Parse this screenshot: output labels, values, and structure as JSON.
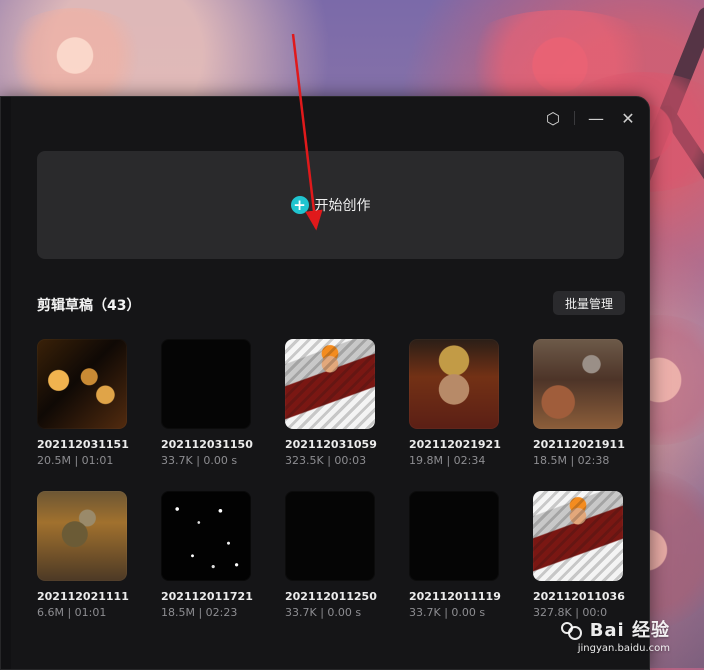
{
  "window": {
    "controls": {
      "settings": "settings-icon",
      "minimize": "minimize-icon",
      "close": "close-icon"
    }
  },
  "create": {
    "label": "开始创作",
    "icon": "plus-circle-icon"
  },
  "drafts": {
    "title": "剪辑草稿（43）",
    "batch_button": "批量管理",
    "items": [
      {
        "name": "202112031151",
        "meta": "20.5M | 01:01",
        "thumb": "t1"
      },
      {
        "name": "202112031150",
        "meta": "33.7K | 0.00 s",
        "thumb": "t2"
      },
      {
        "name": "202112031059",
        "meta": "323.5K | 00:03",
        "thumb": "t3"
      },
      {
        "name": "202112021921",
        "meta": "19.8M | 02:34",
        "thumb": "t4"
      },
      {
        "name": "202112021911",
        "meta": "18.5M | 02:38",
        "thumb": "t5"
      },
      {
        "name": "202112021111",
        "meta": "6.6M | 01:01",
        "thumb": "t6"
      },
      {
        "name": "202112011721",
        "meta": "18.5M | 02:23",
        "thumb": "t7"
      },
      {
        "name": "202112011250",
        "meta": "33.7K | 0.00 s",
        "thumb": "t8"
      },
      {
        "name": "202112011119",
        "meta": "33.7K | 0.00 s",
        "thumb": "t9"
      },
      {
        "name": "202112011036",
        "meta": "327.8K | 00:0",
        "thumb": "t10"
      }
    ]
  },
  "watermark": {
    "main": "Bai 经验",
    "sub": "jingyan.baidu.com"
  },
  "colors": {
    "accent": "#20c5d0",
    "arrow": "#e0191b"
  }
}
